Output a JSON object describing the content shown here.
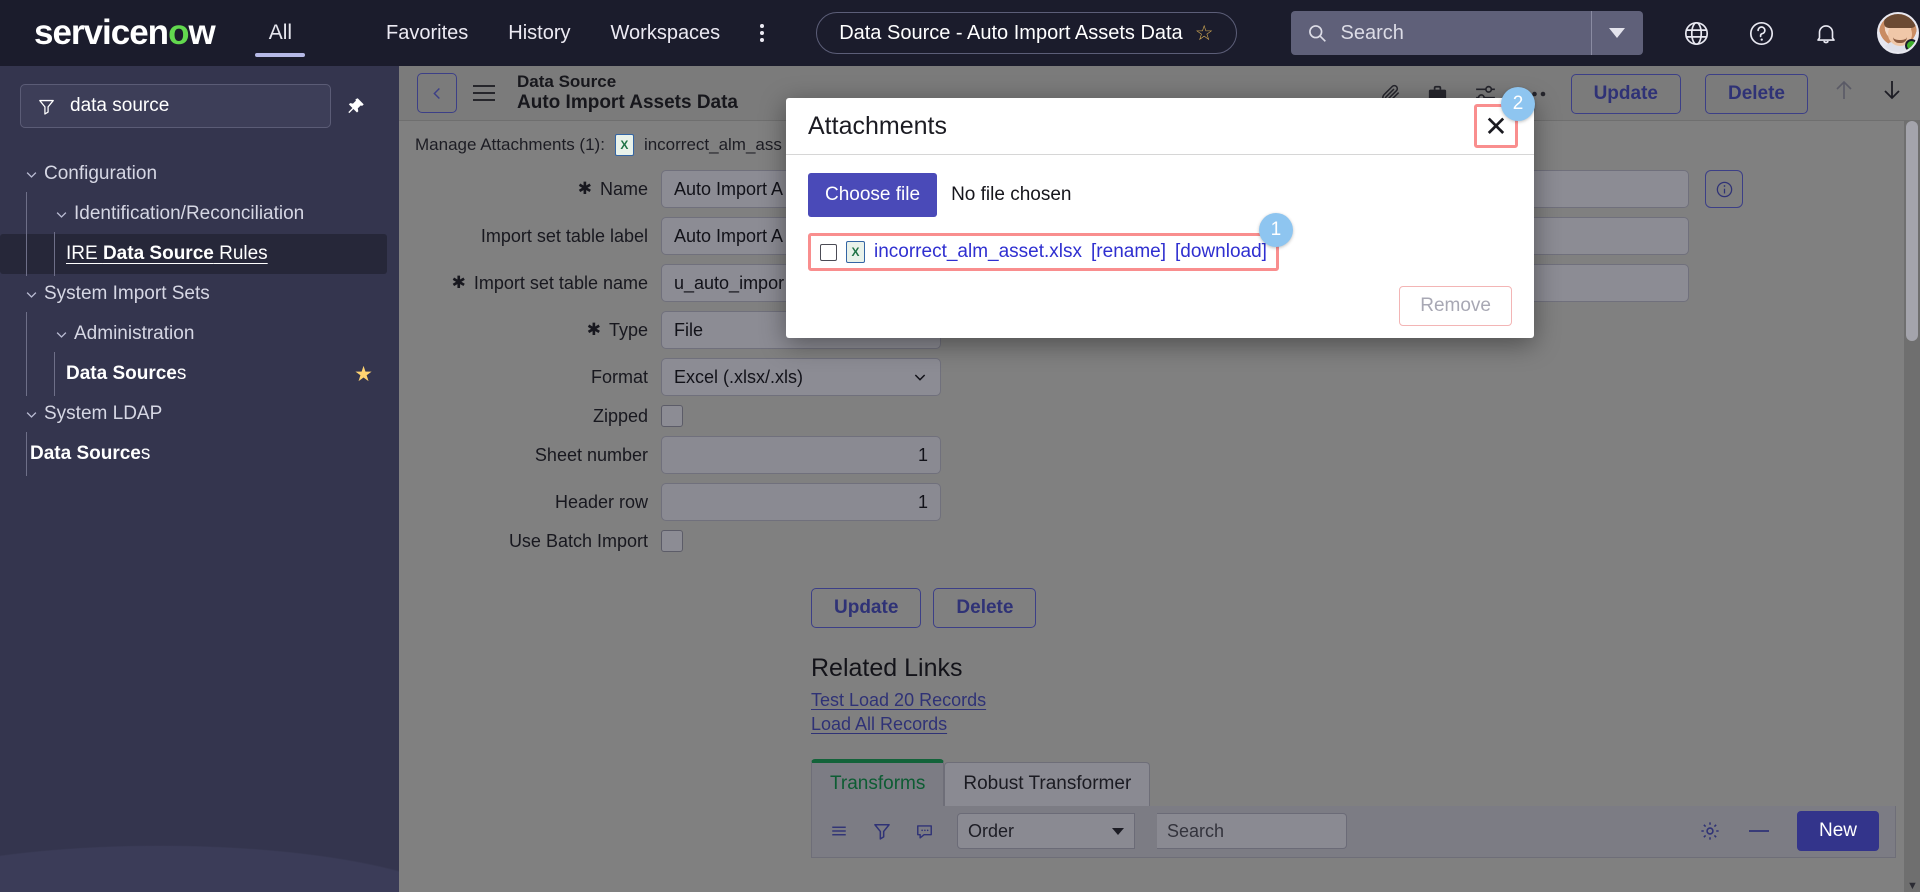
{
  "topnav": {
    "brand_pre": "servicen",
    "brand_o": "o",
    "brand_post": "w",
    "all_label": "All",
    "items": [
      {
        "label": "Favorites"
      },
      {
        "label": "History"
      },
      {
        "label": "Workspaces"
      }
    ],
    "more_label": "more-menu",
    "record_pill": "Data Source - Auto Import Assets Data",
    "search_placeholder": "Search",
    "icons": [
      "globe-icon",
      "help-icon",
      "bell-icon",
      "avatar"
    ]
  },
  "sidebar": {
    "filter_value": "data source",
    "pin_label": "pin-sidebar",
    "tree": [
      {
        "level": 0,
        "label": "Configuration",
        "expanded": true
      },
      {
        "level": 1,
        "label": "Identification/Reconciliation",
        "expanded": true
      },
      {
        "level": 2,
        "label_pre": "IRE ",
        "label_hl": "Data Source",
        "label_post": " Rules",
        "selected": true
      },
      {
        "level": 0,
        "label": "System Import Sets",
        "expanded": true
      },
      {
        "level": 1,
        "label": "Administration",
        "expanded": true
      },
      {
        "level": 2,
        "label_hl": "Data Source",
        "label_post": "s",
        "favorite": true
      },
      {
        "level": 0,
        "label": "System LDAP",
        "expanded": true
      },
      {
        "level": 2,
        "label_hl": "Data Source",
        "label_post": "s"
      }
    ]
  },
  "form_header": {
    "back_label": "back",
    "menu_label": "record-menu",
    "title_line1": "Data Source",
    "title_line2": "Auto Import Assets Data",
    "toolbar_icons": [
      "paperclip-icon",
      "briefcase-icon",
      "sliders-icon",
      "ellipsis-icon"
    ],
    "attachment_badge": "2",
    "update_label": "Update",
    "delete_label": "Delete",
    "prev_label": "previous-record",
    "next_label": "next-record"
  },
  "attachments_line": {
    "prefix": "Manage Attachments (1):",
    "file_icon": "excel-file-icon",
    "filename": "incorrect_alm_ass"
  },
  "form": {
    "fields": [
      {
        "label": "Name",
        "required": true,
        "type": "text",
        "value": "Auto Import A",
        "width": "long",
        "info": true
      },
      {
        "label": "Import set table label",
        "required": false,
        "type": "text",
        "value": "Auto Import A",
        "width": "long"
      },
      {
        "label": "Import set table name",
        "required": true,
        "type": "text",
        "value": "u_auto_impor",
        "width": "long"
      },
      {
        "label": "Type",
        "required": true,
        "type": "select",
        "value": "File",
        "width": "mid"
      },
      {
        "label": "Format",
        "required": false,
        "type": "select",
        "value": "Excel (.xlsx/.xls)",
        "width": "mid"
      },
      {
        "label": "Zipped",
        "required": false,
        "type": "checkbox",
        "value": "",
        "checked": false
      },
      {
        "label": "Sheet number",
        "required": false,
        "type": "number",
        "value": "1",
        "width": "mid"
      },
      {
        "label": "Header row",
        "required": false,
        "type": "number",
        "value": "1",
        "width": "mid"
      },
      {
        "label": "Use Batch Import",
        "required": false,
        "type": "checkbox",
        "value": "",
        "checked": false
      }
    ],
    "update_label": "Update",
    "delete_label": "Delete"
  },
  "related_links": {
    "title": "Related Links",
    "links": [
      "Test Load 20 Records",
      "Load All Records"
    ]
  },
  "tabs": [
    {
      "label": "Transforms",
      "active": true
    },
    {
      "label": "Robust Transformer",
      "active": false
    }
  ],
  "list_toolbar": {
    "icons": [
      "list-menu-icon",
      "filter-icon",
      "comment-icon"
    ],
    "order_value": "Order",
    "search_placeholder": "Search",
    "gear_label": "personalize-list",
    "minimize_label": "minimize-list",
    "new_label": "New"
  },
  "modal": {
    "title": "Attachments",
    "close_label": "close-dialog",
    "choose_file_label": "Choose file",
    "no_file_text": "No file chosen",
    "attachment": {
      "filename": "incorrect_alm_asset.xlsx",
      "rename_label": "[rename]",
      "download_label": "[download]"
    },
    "remove_label": "Remove",
    "badge_attachment": "1",
    "badge_close": "2"
  },
  "colors": {
    "nav_bg": "#1b1c2c",
    "sidebar_bg": "#34354e",
    "main_bg": "#808080",
    "accent_blue": "#33348b",
    "brand_green": "#62d84e",
    "highlight_red": "#f98e8e",
    "badge_blue": "#8ec5f0",
    "tab_green": "#13633a"
  }
}
